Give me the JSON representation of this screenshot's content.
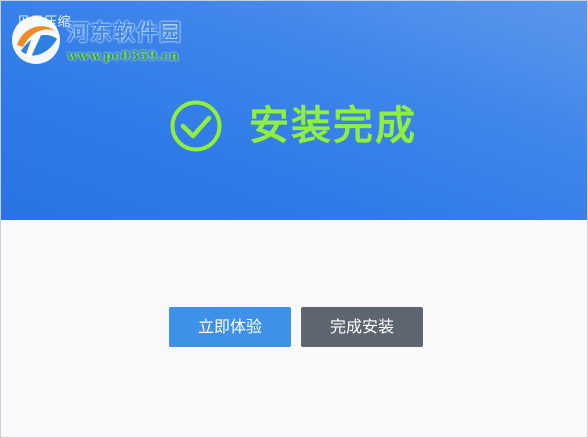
{
  "window": {
    "title": "贝贝压缩"
  },
  "watermark": {
    "site_name": "河东软件园",
    "site_url": "www.pc0359.cn"
  },
  "status": {
    "message": "安装完成",
    "icon": "check-circle-icon",
    "color": "#8ef03a"
  },
  "actions": {
    "try_now_label": "立即体验",
    "finish_install_label": "完成安装"
  },
  "colors": {
    "header_gradient_start": "#5a97ec",
    "header_gradient_end": "#2a73e4",
    "primary_button": "#3d92e8",
    "secondary_button": "#5d6670"
  }
}
